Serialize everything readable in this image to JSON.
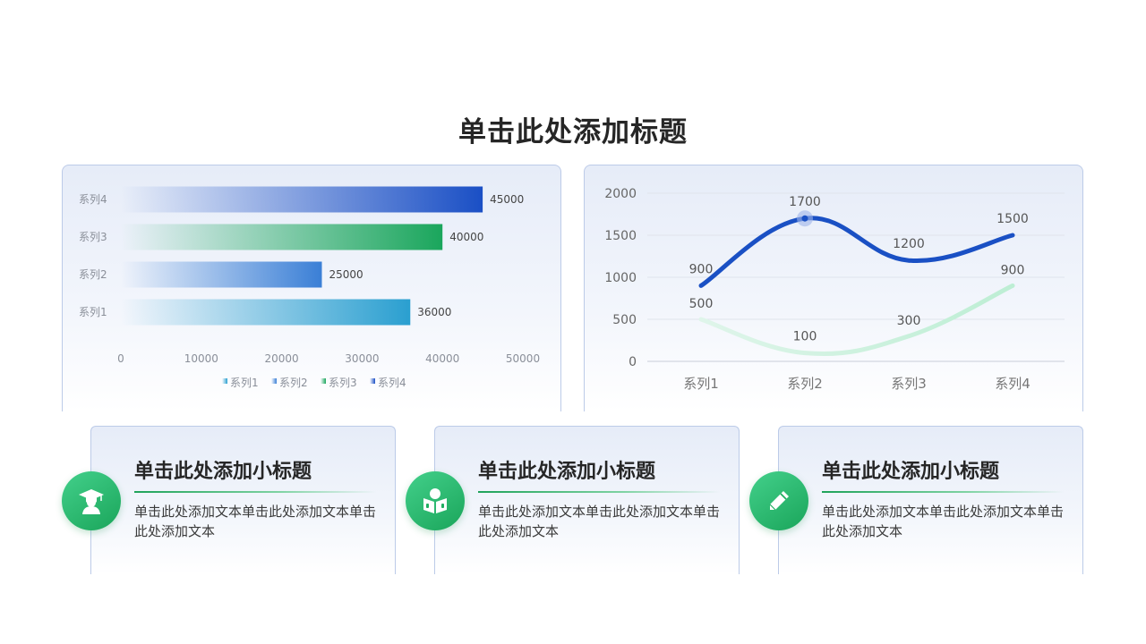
{
  "title": "单击此处添加标题",
  "chart_data": [
    {
      "type": "bar",
      "orientation": "horizontal",
      "categories": [
        "系列1",
        "系列2",
        "系列3",
        "系列4"
      ],
      "values": [
        36000,
        25000,
        40000,
        45000
      ],
      "xlim": [
        0,
        50000
      ],
      "xticks": [
        "0",
        "10000",
        "20000",
        "30000",
        "40000",
        "50000"
      ],
      "legend": {
        "placement": "bottom",
        "entries": [
          "系列1",
          "系列2",
          "系列3",
          "系列4"
        ]
      },
      "colors": [
        "#2a9fd0",
        "#3a7fd6",
        "#1aa65c",
        "#1a4fc5"
      ],
      "grid": false
    },
    {
      "type": "line",
      "categories": [
        "系列1",
        "系列2",
        "系列3",
        "系列4"
      ],
      "series": [
        {
          "values": [
            900,
            1700,
            1200,
            1500
          ],
          "color": "#1a50c4"
        },
        {
          "values": [
            500,
            100,
            300,
            900
          ],
          "color": "#c6f0dc"
        }
      ],
      "ylim": [
        0,
        2000
      ],
      "yticks": [
        "0",
        "500",
        "1000",
        "1500",
        "2000"
      ],
      "smooth": true,
      "grid": true
    }
  ],
  "cards": [
    {
      "title": "单击此处添加小标题",
      "text": "单击此处添加文本单击此处添加文本单击此处添加文本",
      "icon": "graduate-icon"
    },
    {
      "title": "单击此处添加小标题",
      "text": "单击此处添加文本单击此处添加文本单击此处添加文本",
      "icon": "reading-icon"
    },
    {
      "title": "单击此处添加小标题",
      "text": "单击此处添加文本单击此处添加文本单击此处添加文本",
      "icon": "pencil-icon"
    }
  ]
}
